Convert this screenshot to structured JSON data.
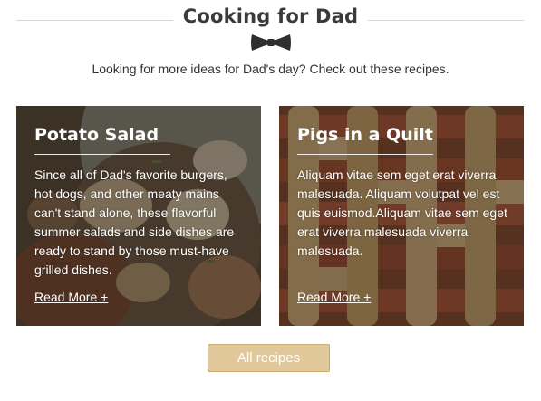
{
  "header": {
    "title": "Cooking for Dad",
    "icon": "bowtie-icon",
    "subtitle": "Looking for more ideas for Dad's day? Check out these recipes."
  },
  "cards": [
    {
      "title": "Potato Salad",
      "text": "Since all of Dad's favorite burgers, hot dogs, and other meaty mains can't stand alone, these flavorful summer salads and side dishes are ready to stand by those must-have grilled dishes.",
      "link": "Read More +"
    },
    {
      "title": "Pigs in a Quilt",
      "text": "Aliquam vitae sem eget erat viverra malesuada. Aliquam volutpat vel est quis euismod.Aliquam vitae sem eget erat viverra malesuada viverra malesuada.",
      "link": "Read More +"
    }
  ],
  "footer": {
    "button_label": "All recipes"
  },
  "colors": {
    "button_bg": "#e0c89a",
    "title_text": "#3a3a3a",
    "divider": "#d6d6d6"
  }
}
